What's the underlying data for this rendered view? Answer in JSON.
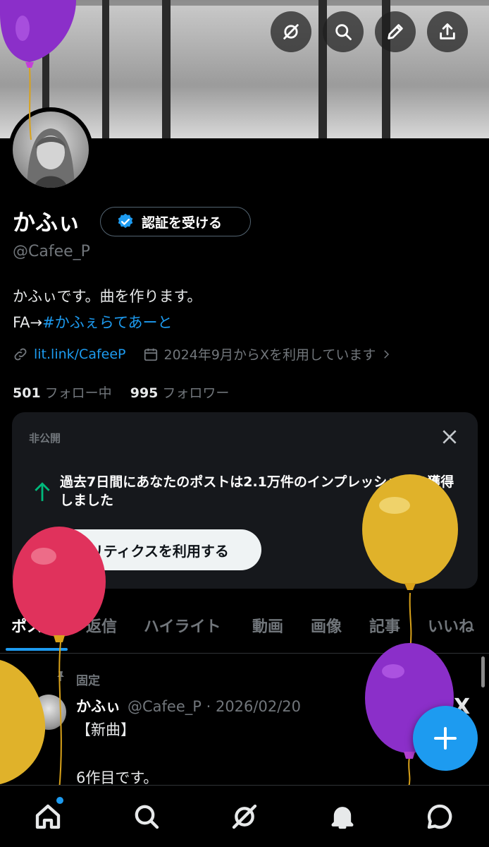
{
  "header": {
    "back_icon": "arrow-left-icon",
    "buttons": [
      "grok-icon",
      "search-icon",
      "edit-pencil-icon",
      "share-icon"
    ]
  },
  "profile": {
    "display_name": "かふぃ",
    "verify_label": "認証を受ける",
    "handle": "@Cafee_P",
    "bio_line1": "かふぃです。曲を作ります。",
    "bio_prefix": "FA→",
    "bio_hashtag": "#かふぇらてあーと",
    "link": "lit.link/CafeeP",
    "joined": "2024年9月からXを利用しています",
    "following_count": "501",
    "following_label": "フォロー中",
    "followers_count": "995",
    "followers_label": "フォロワー"
  },
  "insight_card": {
    "private_label": "非公開",
    "message": "過去7日間にあなたのポストは2.1万件のインプレッションを獲得しました",
    "button_label": "アナリティクスを利用する"
  },
  "tabs": [
    "ポスト",
    "返信",
    "ハイライト",
    "動画",
    "画像",
    "記事",
    "いいね"
  ],
  "active_tab": "ポスト",
  "pinned_post": {
    "pinned_label": "固定",
    "author": "かふぃ",
    "handle_date": "@Cafee_P · 2026/02/20",
    "line1": "【新曲】",
    "line2": "6作目です。",
    "logo": "X"
  },
  "bottom_nav": [
    "home-icon",
    "search-icon",
    "grok-icon",
    "notifications-icon",
    "messages-icon"
  ],
  "colors": {
    "accent": "#1d9bf0",
    "background": "#000000",
    "card": "#16181c",
    "muted": "#71767b",
    "positive": "#00ba7c"
  }
}
